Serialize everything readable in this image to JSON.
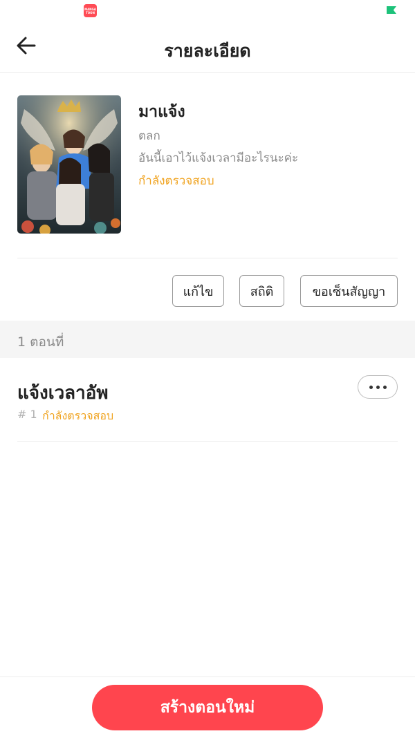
{
  "status_bar": {
    "app_icon": "mangatoon-app-icon",
    "app_icon_text_line1": "MANGA",
    "app_icon_text_line2": "TOON",
    "battery_icon": "battery-icon",
    "accent_color": "#1dc27a"
  },
  "header": {
    "title": "รายละเอียด",
    "back_icon": "arrow-left-icon"
  },
  "story": {
    "title": "มาแจ้ง",
    "genre": "ตลก",
    "description": "อันนี้เอาไว้แจ้งเวลามีอะไรนะค่ะ",
    "status": "กำลังตรวจสอบ",
    "status_color": "#f0a31f"
  },
  "actions": {
    "edit": "แก้ไข",
    "stats": "สถิติ",
    "contract": "ขอเซ็นสัญญา"
  },
  "episodes": {
    "count_label": "1 ตอนที่",
    "items": [
      {
        "title": "แจ้งเวลาอัพ",
        "number": "# 1",
        "status": "กำลังตรวจสอบ",
        "more_icon": "more-horizontal-icon"
      }
    ]
  },
  "footer": {
    "create_button": "สร้างตอนใหม่",
    "button_color": "#ff454e"
  }
}
